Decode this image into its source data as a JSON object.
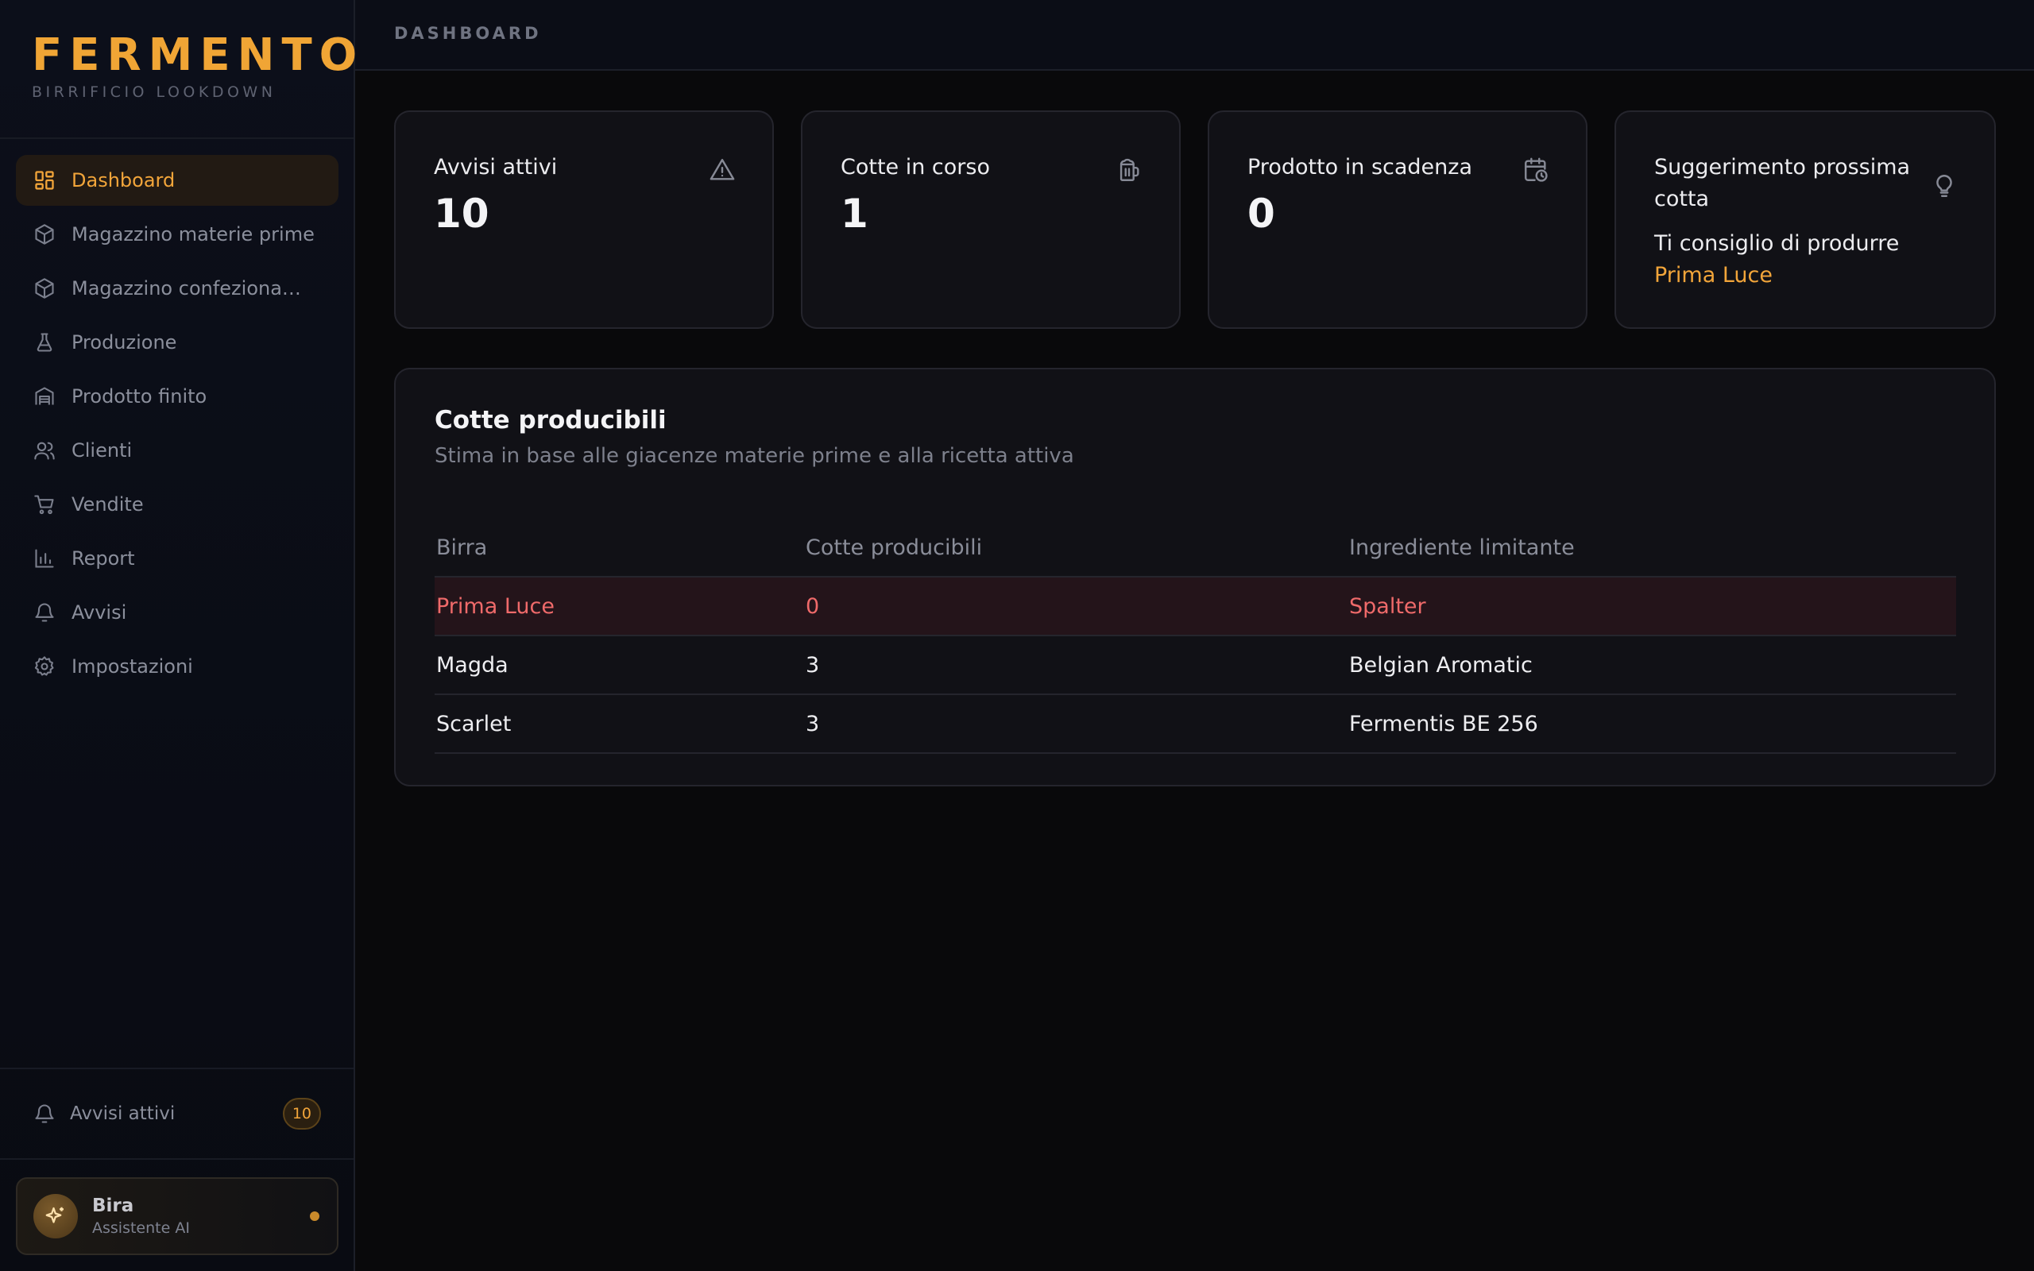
{
  "brand": {
    "name": "FERMENTO",
    "subtitle": "BIRRIFICIO LOOKDOWN"
  },
  "nav": [
    {
      "label": "Dashboard",
      "icon": "dashboard-icon",
      "active": true
    },
    {
      "label": "Magazzino materie prime",
      "icon": "box-icon"
    },
    {
      "label": "Magazzino confezionamento",
      "icon": "box-icon"
    },
    {
      "label": "Produzione",
      "icon": "flask-icon"
    },
    {
      "label": "Prodotto finito",
      "icon": "warehouse-icon"
    },
    {
      "label": "Clienti",
      "icon": "users-icon"
    },
    {
      "label": "Vendite",
      "icon": "cart-icon"
    },
    {
      "label": "Report",
      "icon": "bar-chart-icon"
    },
    {
      "label": "Avvisi",
      "icon": "bell-icon"
    },
    {
      "label": "Impostazioni",
      "icon": "gear-icon"
    }
  ],
  "sidebar_footer": {
    "alerts_label": "Avvisi attivi",
    "alerts_count": "10",
    "assistant_name": "Bira",
    "assistant_role": "Assistente AI"
  },
  "topbar": {
    "breadcrumb": "DASHBOARD"
  },
  "cards": [
    {
      "title": "Avvisi attivi",
      "value": "10",
      "icon": "alert-triangle-icon"
    },
    {
      "title": "Cotte in corso",
      "value": "1",
      "icon": "beer-mug-icon"
    },
    {
      "title": "Prodotto in scadenza",
      "value": "0",
      "icon": "calendar-clock-icon"
    },
    {
      "title": "Suggerimento prossima cotta",
      "text_prefix": "Ti consiglio di produrre ",
      "highlight": "Prima Luce",
      "icon": "lightbulb-icon"
    }
  ],
  "panel": {
    "title": "Cotte producibili",
    "subtitle": "Stima in base alle giacenze materie prime e alla ricetta attiva",
    "columns": [
      "Birra",
      "Cotte producibili",
      "Ingrediente limitante"
    ],
    "rows": [
      {
        "beer": "Prima Luce",
        "batches": "0",
        "limiting": "Spalter",
        "warning": true
      },
      {
        "beer": "Magda",
        "batches": "3",
        "limiting": "Belgian Aromatic",
        "warning": false
      },
      {
        "beer": "Scarlet",
        "batches": "3",
        "limiting": "Fermentis BE 256",
        "warning": false
      }
    ]
  },
  "colors": {
    "accent": "#f2a53a",
    "warning": "#ef6a6a",
    "background": "#09090b"
  }
}
